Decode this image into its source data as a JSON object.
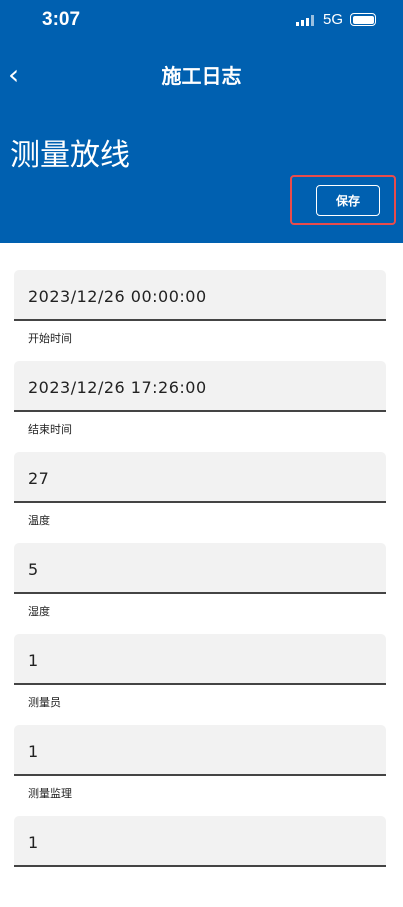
{
  "status_bar": {
    "time": "3:07",
    "network": "5G",
    "signal-icon": "signal-icon",
    "battery_icon": "battery-icon"
  },
  "header": {
    "title": "施工日志",
    "page_title": "测量放线",
    "save_label": "保存",
    "back_icon": "chevron-left-icon"
  },
  "colors": {
    "header": "#0060b0",
    "highlight": "#e94c4c"
  },
  "fields": [
    {
      "value": "2023/12/26 00:00:00",
      "label": "开始时间"
    },
    {
      "value": "2023/12/26 17:26:00",
      "label": "结束时间"
    },
    {
      "value": "27",
      "label": "温度"
    },
    {
      "value": "5",
      "label": "湿度"
    },
    {
      "value": "1",
      "label": "测量员"
    },
    {
      "value": "1",
      "label": "测量监理"
    },
    {
      "value": "1",
      "label": ""
    }
  ]
}
